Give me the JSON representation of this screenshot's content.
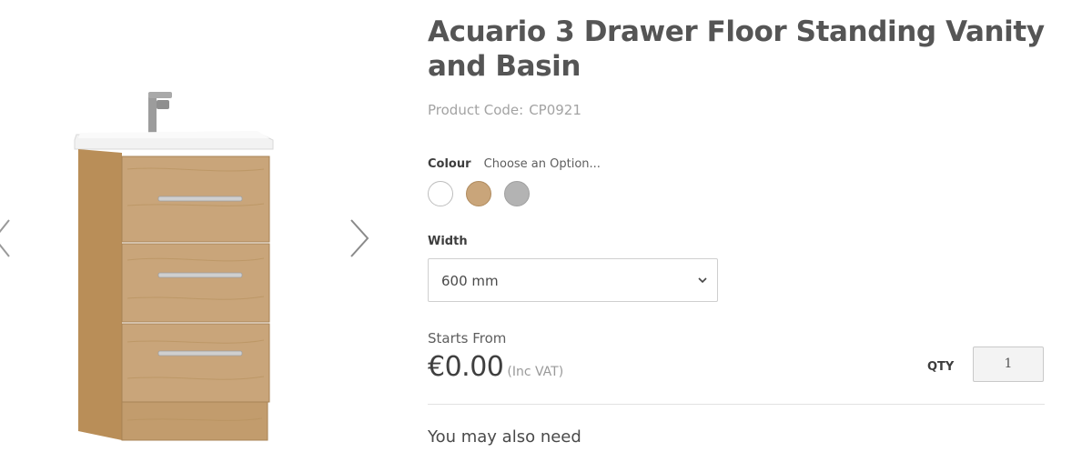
{
  "product": {
    "title": "Acuario 3 Drawer Floor Standing Vanity and Basin",
    "code_label": "Product Code:",
    "code_value": "CP0921"
  },
  "gallery": {
    "prev_icon": "chevron-left-icon",
    "next_icon": "chevron-right-icon"
  },
  "options": {
    "colour_label": "Colour",
    "colour_hint": "Choose an Option...",
    "colours": [
      {
        "name": "white",
        "hex": "#ffffff"
      },
      {
        "name": "oak",
        "hex": "#c9a57a"
      },
      {
        "name": "grey",
        "hex": "#b3b3b3"
      }
    ],
    "width_label": "Width",
    "width_value": "600 mm"
  },
  "pricing": {
    "starts_from": "Starts From",
    "price": "€0.00",
    "vat_note": "(Inc VAT)"
  },
  "quantity": {
    "label": "QTY",
    "value": "1"
  },
  "related": {
    "heading": "You may also need"
  },
  "colors": {
    "title": "#555555",
    "muted": "#a3a3a3",
    "wood": "#c9a57a",
    "basin": "#f1f1f1"
  }
}
